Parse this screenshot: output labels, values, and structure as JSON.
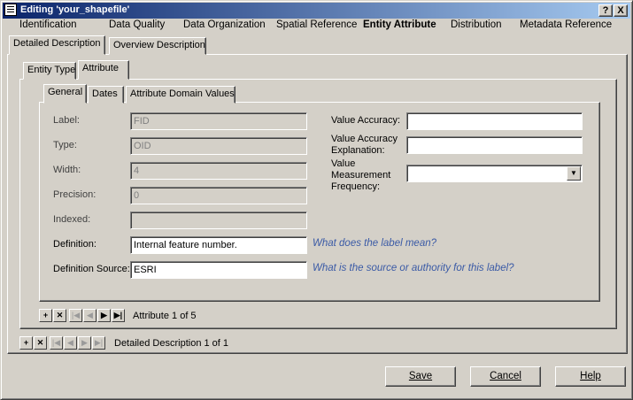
{
  "window": {
    "title": "Editing 'your_shapefile'",
    "buttons": [
      "?",
      "X"
    ]
  },
  "top_tabs": [
    "Identification",
    "Data Quality",
    "Data Organization",
    "Spatial Reference",
    "Entity Attribute",
    "Distribution",
    "Metadata Reference"
  ],
  "top_tabs_active": "Entity Attribute",
  "desc_tabs": [
    "Detailed Description",
    "Overview Description"
  ],
  "entity_tabs": [
    "Entity Type",
    "Attribute"
  ],
  "attr_tabs": [
    "General",
    "Dates",
    "Attribute Domain Values"
  ],
  "fields": {
    "label": {
      "label": "Label:",
      "value": "FID"
    },
    "type": {
      "label": "Type:",
      "value": "OID"
    },
    "width": {
      "label": "Width:",
      "value": "4"
    },
    "precision": {
      "label": "Precision:",
      "value": "0"
    },
    "indexed": {
      "label": "Indexed:",
      "value": ""
    },
    "definition": {
      "label": "Definition:",
      "value": "Internal feature number.",
      "hint": "What does the label mean?"
    },
    "definition_source": {
      "label": "Definition Source:",
      "value": "ESRI",
      "hint": "What is the source or authority for this label?"
    },
    "value_accuracy": {
      "label": "Value Accuracy:",
      "value": ""
    },
    "value_accuracy_explanation": {
      "label_line1": "Value Accuracy",
      "label_line2": "Explanation:",
      "value": ""
    },
    "value_measurement_frequency": {
      "label_line1": "Value",
      "label_line2": "Measurement",
      "label_line3": "Frequency:",
      "value": ""
    }
  },
  "attribute_nav": {
    "status": "Attribute 1 of 5"
  },
  "description_nav": {
    "status": "Detailed Description 1 of 1"
  },
  "footer": {
    "save": "Save",
    "cancel": "Cancel",
    "help": "Help"
  }
}
